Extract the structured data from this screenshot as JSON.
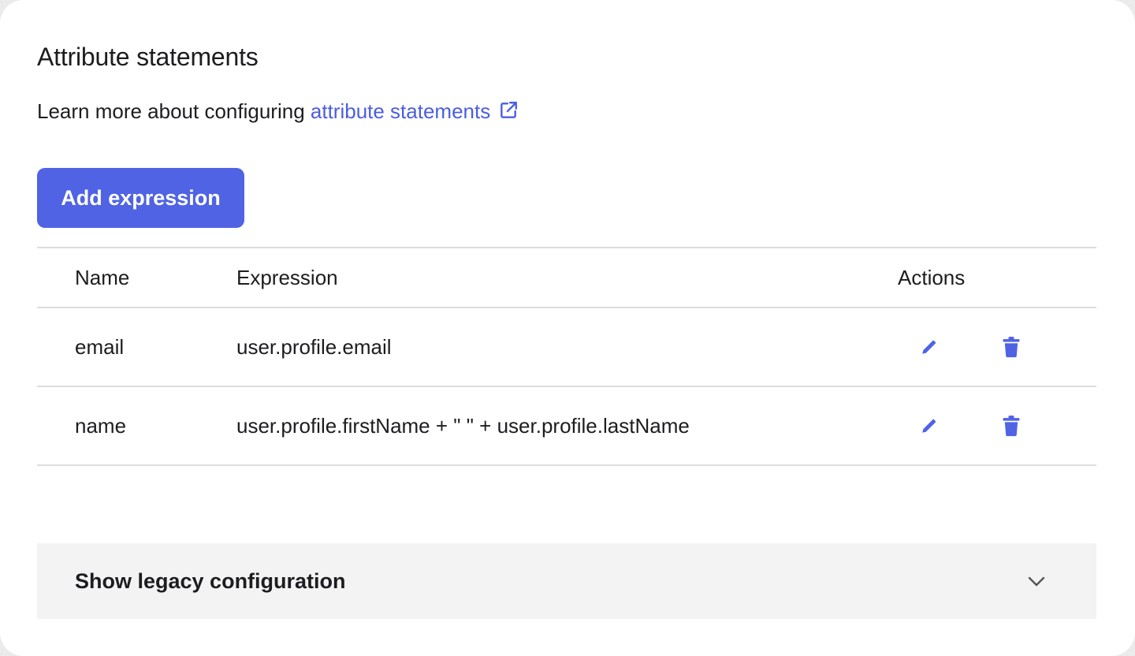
{
  "section": {
    "title": "Attribute statements",
    "learn_prefix": "Learn more about configuring ",
    "learn_link": "attribute statements",
    "add_button": "Add expression"
  },
  "table": {
    "headers": {
      "name": "Name",
      "expression": "Expression",
      "actions": "Actions"
    },
    "rows": [
      {
        "name": "email",
        "expression": "user.profile.email"
      },
      {
        "name": "name",
        "expression": "user.profile.firstName + \" \" + user.profile.lastName"
      }
    ]
  },
  "legacy": {
    "label": "Show legacy configuration"
  },
  "icons": {
    "external_link": "external-link-icon",
    "edit": "pencil-icon",
    "delete": "trash-icon",
    "expand": "chevron-down-icon"
  },
  "colors": {
    "accent": "#4f63e4",
    "link": "#4b5ee0",
    "text": "#1d1d21",
    "divider": "#dcdcdf",
    "legacy_bg": "#f3f3f3"
  }
}
